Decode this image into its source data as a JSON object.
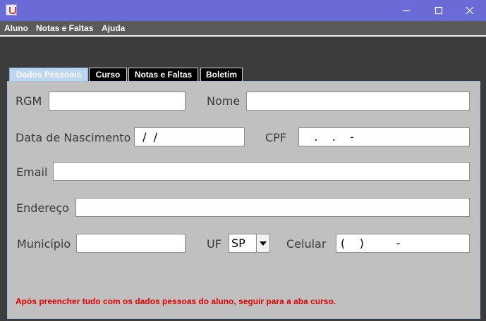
{
  "window": {
    "title": "",
    "controls": {
      "minimize": "minimize",
      "maximize": "maximize",
      "close": "close"
    }
  },
  "menu": {
    "items": [
      "Aluno",
      "Notas e Faltas",
      "Ajuda"
    ]
  },
  "tabs": [
    {
      "label": "Dados Pessoais",
      "active": true
    },
    {
      "label": "Curso",
      "active": false
    },
    {
      "label": "Notas e Faltas",
      "active": false
    },
    {
      "label": "Boletim",
      "active": false
    }
  ],
  "form": {
    "rgm": {
      "label": "RGM",
      "value": ""
    },
    "nome": {
      "label": "Nome",
      "value": ""
    },
    "nascimento": {
      "label": "Data de Nascimento",
      "value": " /  /"
    },
    "cpf": {
      "label": "CPF",
      "value": "   .    .    -"
    },
    "email": {
      "label": "Email",
      "value": ""
    },
    "endereco": {
      "label": "Endereço",
      "value": ""
    },
    "municipio": {
      "label": "Município",
      "value": ""
    },
    "uf": {
      "label": "UF",
      "value": "SP"
    },
    "celular": {
      "label": "Celular",
      "value": "(    )         -"
    }
  },
  "hint": "Após preencher tudo com os dados pessoas do aluno, seguir para a aba curso.",
  "colors": {
    "titlebar": "#6a6bd6",
    "hint": "#e00000",
    "panel": "#c0c0c0"
  }
}
